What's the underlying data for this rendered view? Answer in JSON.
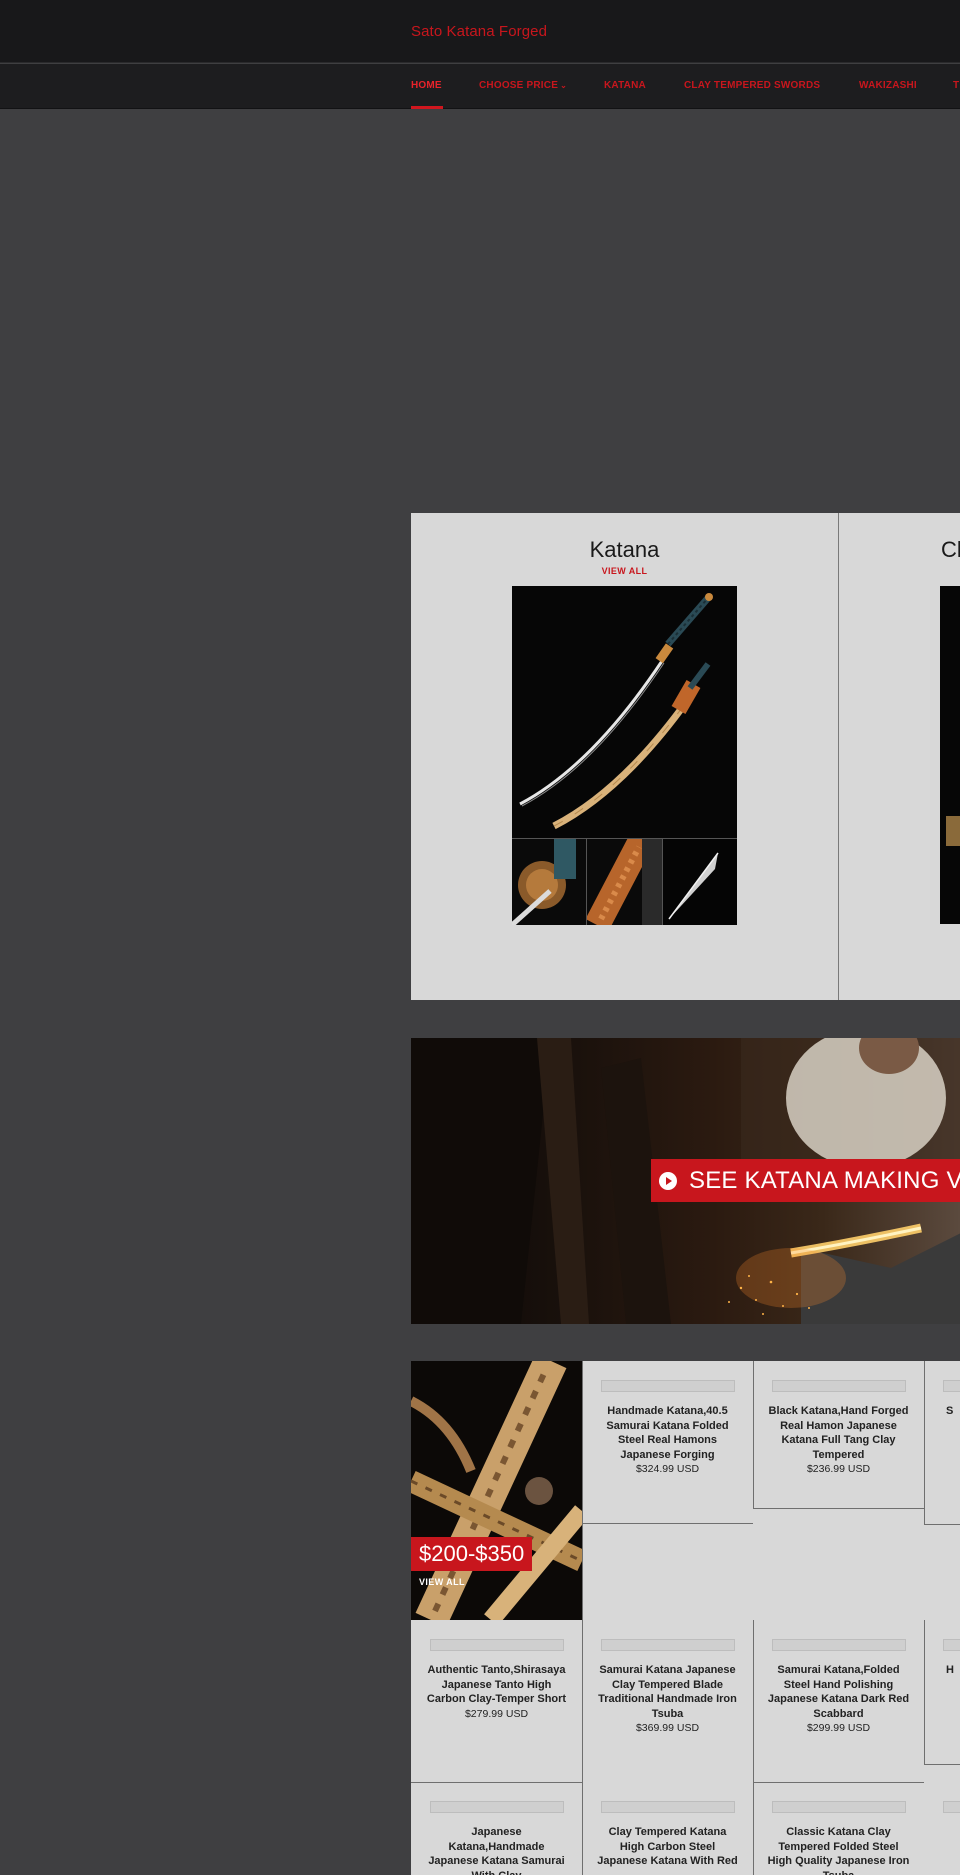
{
  "header": {
    "brand": "Sato Katana Forged"
  },
  "nav": {
    "items": [
      {
        "label": "HOME",
        "active": true
      },
      {
        "label": "CHOOSE PRICE",
        "has_dropdown": true
      },
      {
        "label": "KATANA"
      },
      {
        "label": "CLAY TEMPERED SWORDS"
      },
      {
        "label": "WAKIZASHI"
      },
      {
        "label": "T"
      }
    ]
  },
  "collections": [
    {
      "title": "Katana",
      "view_all": "VIEW ALL"
    },
    {
      "title": "Cl"
    }
  ],
  "video_banner": {
    "label": "SEE KATANA MAKING V"
  },
  "promo": {
    "price_range": "$200-$350",
    "view_all": "VIEW ALL"
  },
  "products": [
    {
      "name": "Handmade Katana,40.5 Samurai Katana Folded Steel Real Hamons Japanese Forging",
      "price": "$324.99",
      "currency": "USD"
    },
    {
      "name": "Black Katana,Hand Forged Real Hamon Japanese Katana Full Tang Clay Tempered",
      "price": "$236.99",
      "currency": "USD"
    },
    {
      "name": "S",
      "price": "",
      "currency": ""
    },
    {
      "name": "Authentic Tanto,Shirasaya Japanese Tanto High Carbon Clay-Temper Short",
      "price": "$279.99",
      "currency": "USD"
    },
    {
      "name": "Samurai Katana Japanese Clay Tempered Blade Traditional Handmade Iron Tsuba",
      "price": "$369.99",
      "currency": "USD"
    },
    {
      "name": "Samurai Katana,Folded Steel Hand Polishing Japanese Katana Dark Red Scabbard",
      "price": "$299.99",
      "currency": "USD"
    },
    {
      "name": "H",
      "price": "",
      "currency": ""
    },
    {
      "name": "Japanese Katana,Handmade Japanese Katana Samurai With Clay",
      "price": "",
      "currency": ""
    },
    {
      "name": "Clay Tempered Katana High Carbon Steel Japanese Katana With Red",
      "price": "",
      "currency": ""
    },
    {
      "name": "Classic Katana Clay Tempered Folded Steel High Quality Japanese Iron Tsuba",
      "price": "",
      "currency": ""
    }
  ],
  "colors": {
    "accent": "#c8161d",
    "page_bg": "#3f3f41",
    "header_bg": "#18181a",
    "panel_bg": "#d8d8d8"
  }
}
